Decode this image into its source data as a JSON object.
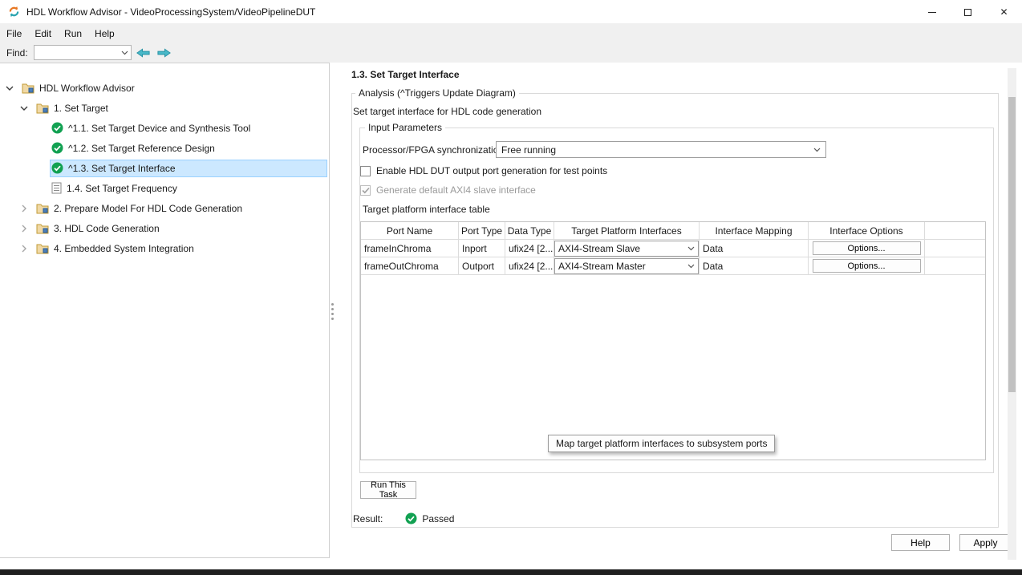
{
  "colors": {
    "check_green": "#12a152",
    "selection_bg": "#cce8ff",
    "selection_border": "#99d1ff",
    "arrow_teal": "#49b8c8",
    "folder_tan": "#f0d9a6",
    "toolbar_bg": "#f0f0f0"
  },
  "icons": {
    "app-icon": "circular-arrows",
    "minimize-icon": "—",
    "maximize-icon": "□",
    "close-icon": "✕",
    "expander-expanded-icon": "⌄",
    "expander-collapsed-icon": "›",
    "folder-icon": "folder",
    "passed-check-icon": "✓",
    "task-icon": "document",
    "find-back-icon": "⇦",
    "find-forward-icon": "⇨",
    "dropdown-chevron-icon": "⌄"
  },
  "window": {
    "title": "HDL Workflow Advisor - VideoProcessingSystem/VideoPipelineDUT"
  },
  "menu": {
    "items": [
      {
        "label": "File"
      },
      {
        "label": "Edit"
      },
      {
        "label": "Run"
      },
      {
        "label": "Help"
      }
    ]
  },
  "toolbar": {
    "find_label": "Find:",
    "find_value": ""
  },
  "tree": {
    "items": [
      {
        "label": "HDL Workflow Advisor"
      },
      {
        "label": "1. Set Target"
      },
      {
        "label": "^1.1. Set Target Device and Synthesis Tool"
      },
      {
        "label": "^1.2. Set Target Reference Design"
      },
      {
        "label": "^1.3. Set Target Interface"
      },
      {
        "label": "1.4. Set Target Frequency"
      },
      {
        "label": "2. Prepare Model For HDL Code Generation"
      },
      {
        "label": "3. HDL Code Generation"
      },
      {
        "label": "4. Embedded System Integration"
      }
    ]
  },
  "panel": {
    "title": "1.3. Set Target Interface",
    "analysis_group": "Analysis (^Triggers Update Diagram)",
    "description": "Set target interface for HDL code generation",
    "input_group": "Input Parameters",
    "sync_label": "Processor/FPGA synchronization:",
    "sync_value": "Free running",
    "checkbox1_label": "Enable HDL DUT output port generation for test points",
    "checkbox2_label": "Generate default AXI4 slave interface",
    "table_label": "Target platform interface table",
    "table": {
      "headers": [
        "Port Name",
        "Port Type",
        "Data Type",
        "Target Platform Interfaces",
        "Interface Mapping",
        "Interface Options"
      ],
      "rows": [
        {
          "port_name": "frameInChroma",
          "port_type": "Inport",
          "data_type": "ufix24 [2...",
          "interface": "AXI4-Stream Slave",
          "mapping": "Data",
          "options_label": "Options..."
        },
        {
          "port_name": "frameOutChroma",
          "port_type": "Outport",
          "data_type": "ufix24 [2...",
          "interface": "AXI4-Stream Master",
          "mapping": "Data",
          "options_label": "Options..."
        }
      ]
    },
    "tooltip": "Map target platform interfaces to subsystem ports",
    "run_button": "Run This Task",
    "result_label": "Result:",
    "result_value": "Passed",
    "help_button": "Help",
    "apply_button": "Apply"
  }
}
